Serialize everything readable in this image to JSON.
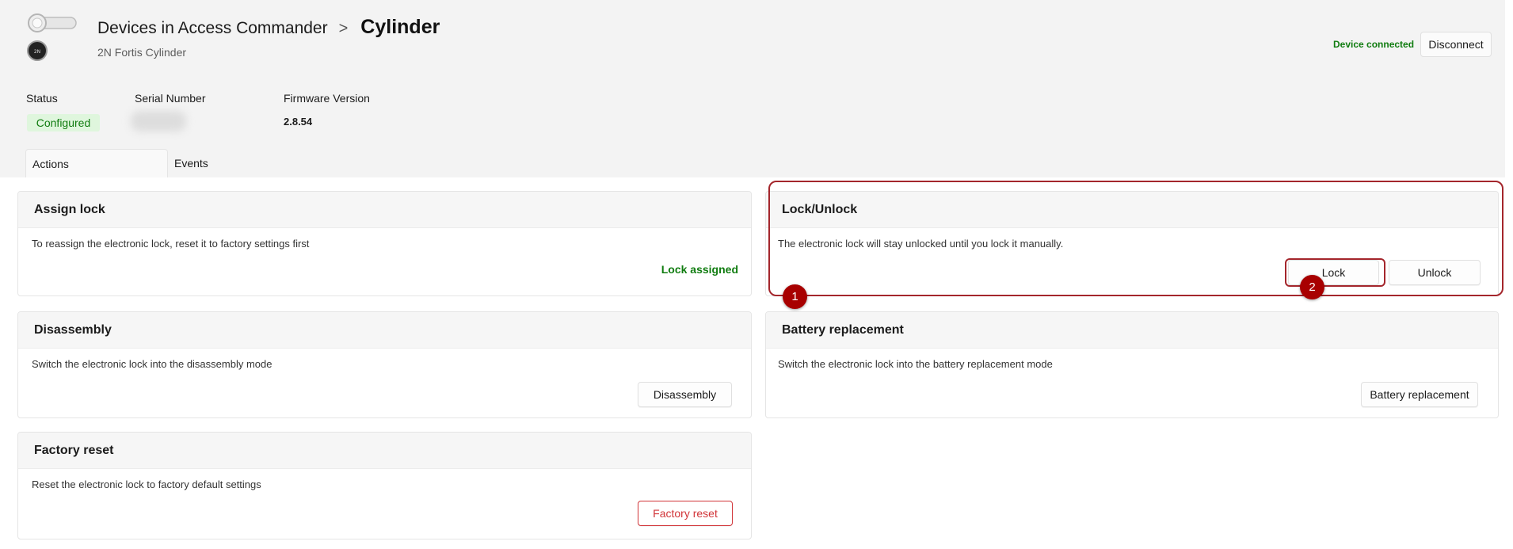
{
  "header": {
    "breadcrumb_parent": "Devices in Access Commander",
    "breadcrumb_separator": ">",
    "breadcrumb_current": "Cylinder",
    "subtitle": "2N Fortis Cylinder",
    "connection_status": "Device connected",
    "disconnect_label": "Disconnect"
  },
  "info": {
    "status_label": "Status",
    "status_value": "Configured",
    "serial_label": "Serial Number",
    "firmware_label": "Firmware Version",
    "firmware_value": "2.8.54"
  },
  "tabs": [
    {
      "label": "Actions",
      "active": true
    },
    {
      "label": "Events",
      "active": false
    }
  ],
  "cards": {
    "assign": {
      "title": "Assign lock",
      "description": "To reassign the electronic lock, reset it to factory settings first",
      "status": "Lock assigned"
    },
    "lock_unlock": {
      "title": "Lock/Unlock",
      "description": "The electronic lock will stay unlocked until you lock it manually.",
      "lock_label": "Lock",
      "unlock_label": "Unlock"
    },
    "disassembly": {
      "title": "Disassembly",
      "description": "Switch the electronic lock into the disassembly mode",
      "button_label": "Disassembly"
    },
    "battery": {
      "title": "Battery replacement",
      "description": "Switch the electronic lock into the battery replacement mode",
      "button_label": "Battery replacement"
    },
    "factory": {
      "title": "Factory reset",
      "description": "Reset the electronic lock to factory default settings",
      "button_label": "Factory reset"
    }
  },
  "annotations": {
    "marker_1": "1",
    "marker_2": "2",
    "highlight_color": "#a4262c",
    "marker_color": "#a80000"
  },
  "colors": {
    "success": "#107c10",
    "danger": "#d13438",
    "badge_bg": "#dff6dd"
  }
}
